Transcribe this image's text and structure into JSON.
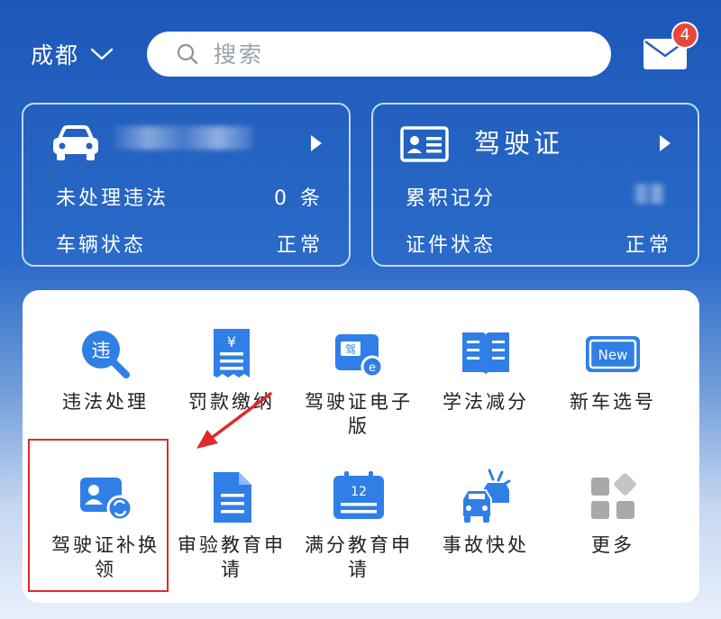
{
  "header": {
    "city": "成都",
    "search_placeholder": "搜索",
    "mail_badge": "4"
  },
  "vehicle_card": {
    "rows": [
      {
        "label": "未处理违法",
        "value": "0 条"
      },
      {
        "label": "车辆状态",
        "value": "正常"
      }
    ]
  },
  "license_card": {
    "title": "驾驶证",
    "rows": [
      {
        "label": "累积记分",
        "value": ""
      },
      {
        "label": "证件状态",
        "value": "正常"
      }
    ]
  },
  "services": [
    {
      "label": "违法处理",
      "icon": "violation-search-icon"
    },
    {
      "label": "罚款缴纳",
      "icon": "fine-payment-icon"
    },
    {
      "label": "驾驶证电子版",
      "icon": "e-license-icon"
    },
    {
      "label": "学法减分",
      "icon": "study-book-icon"
    },
    {
      "label": "新车选号",
      "icon": "new-plate-icon"
    },
    {
      "label": "驾驶证补换领",
      "icon": "license-renew-icon"
    },
    {
      "label": "审验教育申请",
      "icon": "document-icon"
    },
    {
      "label": "满分教育申请",
      "icon": "calendar-12-icon"
    },
    {
      "label": "事故快处",
      "icon": "car-accident-icon"
    },
    {
      "label": "更多",
      "icon": "more-grid-icon"
    }
  ],
  "colors": {
    "accent_blue": "#2f7fe6",
    "highlight_red": "#e02a2a",
    "badge_red": "#e8473c"
  }
}
